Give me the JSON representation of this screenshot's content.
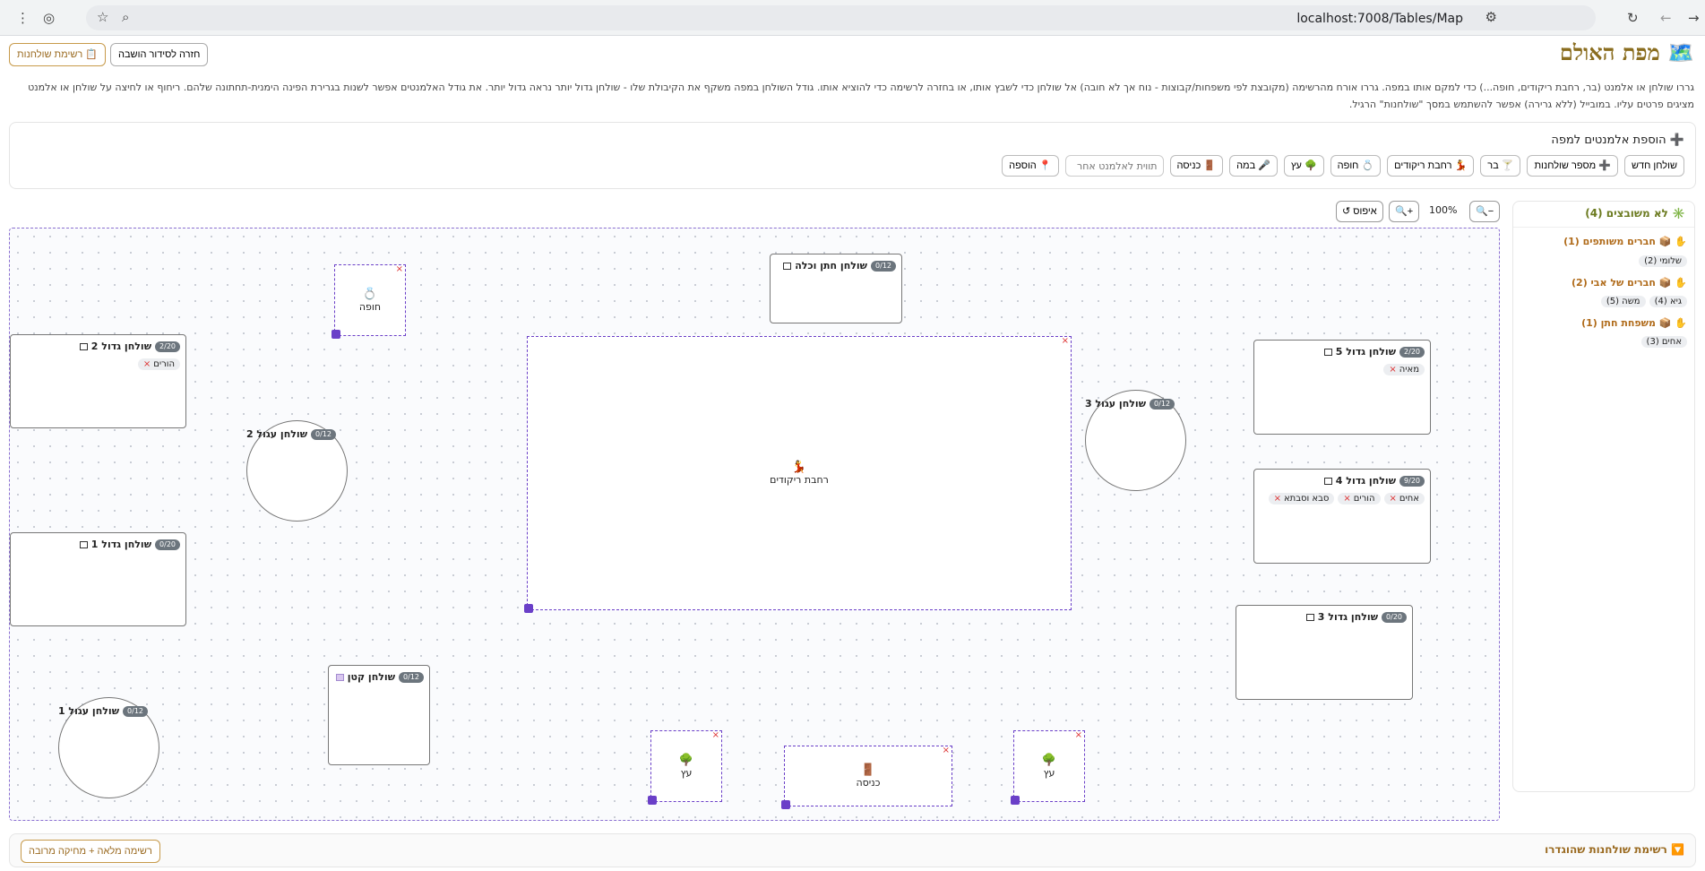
{
  "browser": {
    "url": "localhost:7008/Tables/Map",
    "icons": [
      "menu-dots-icon",
      "profile-icon",
      "star-icon",
      "zoom-icon",
      "site-settings-icon",
      "reload-icon",
      "back-icon",
      "forward-icon"
    ]
  },
  "header": {
    "title": "מפת האולם",
    "title_icon": "🗺️",
    "back_button": "חזרה לסידור הושבה",
    "tables_list_button": "📋 רשימת שולחנות",
    "description": "גררו שולחן או אלמנט (בר, רחבת ריקודים, חופה...) כדי למקם אותו במפה. גררו אורח מהרשימה (מקובצת לפי משפחות/קבוצות - נוח אך לא חובה) אל שולחן כדי לשבץ אותו, או בחזרה לרשימה כדי להוציא אותו. גודל השולחן במפה משקף את הקיבולת שלו - שולחן גדול יותר נראה גדול יותר. את גודל האלמנטים אפשר לשנות בגרירת הפינה הימנית-תחתונה שלהם. ריחוף או לחיצה על שולחן או אלמנט מציגים פרטים עליו. במובייל (ללא גרירה) אפשר להשתמש במסך \"שולחנות\" הרגיל."
  },
  "add_panel": {
    "title": "הוספת אלמנטים למפה",
    "title_icon": "➕",
    "buttons": [
      {
        "name": "new-table",
        "label": "שולחן חדש"
      },
      {
        "name": "table-count",
        "label": "➕ מספר שולחנות"
      },
      {
        "name": "bar",
        "label": "🍸 בר"
      },
      {
        "name": "dance-floor",
        "label": "💃 רחבת ריקודים"
      },
      {
        "name": "chuppah",
        "label": "💍 חופה"
      },
      {
        "name": "tree",
        "label": "🌳 עץ"
      },
      {
        "name": "stage",
        "label": "🎤 במה"
      },
      {
        "name": "entrance",
        "label": "🚪 כניסה"
      }
    ],
    "other_placeholder": "תווית לאלמנט אחר",
    "add_button": "📍 הוספה"
  },
  "zoom": {
    "zoom_out": "🔍−",
    "level": "100%",
    "zoom_in": "🔍+",
    "reset": "↺ איפוס"
  },
  "tables": [
    {
      "name": "שולחן חתן וכלה",
      "count": "0/12",
      "guests": []
    },
    {
      "name": "שולחן גדול 2",
      "count": "2/20",
      "guests": [
        "הורים"
      ]
    },
    {
      "name": "שולחן עגול 2",
      "count": "0/12",
      "guests": []
    },
    {
      "name": "שולחן גדול 1",
      "count": "0/20",
      "guests": []
    },
    {
      "name": "שולחן קטן",
      "count": "0/12",
      "guests": []
    },
    {
      "name": "שולחן עגול 1",
      "count": "0/12",
      "guests": []
    },
    {
      "name": "שולחן עגול 3",
      "count": "0/12",
      "guests": []
    },
    {
      "name": "שולחן גדול 5",
      "count": "2/20",
      "guests": [
        "מאיה"
      ]
    },
    {
      "name": "שולחן גדול 4",
      "count": "9/20",
      "guests": [
        "אחים",
        "הורים",
        "סבא וסבתא"
      ]
    },
    {
      "name": "שולחן גדול 3",
      "count": "0/20",
      "guests": []
    }
  ],
  "elements": [
    {
      "emoji": "💍",
      "label": "חופה"
    },
    {
      "emoji": "💃",
      "label": "רחבת ריקודים"
    },
    {
      "emoji": "🌳",
      "label": "עץ"
    },
    {
      "emoji": "🚪",
      "label": "כניסה"
    },
    {
      "emoji": "🌳",
      "label": "עץ"
    }
  ],
  "sidebar": {
    "title": "✳️ לא משובצים (4)",
    "groups": [
      {
        "title": "✋ 📦 חברים משותפים (1)",
        "guests": [
          "שלומי (2)"
        ]
      },
      {
        "title": "✋ 📦 חברים של אבי (2)",
        "guests": [
          "גיא (4)",
          "משה (5)"
        ]
      },
      {
        "title": "✋ 📦 משפחת חתן (1)",
        "guests": [
          "אחים (3)"
        ]
      }
    ]
  },
  "bottom": {
    "title": "🔽 רשימת שולחנות שהוגדרו",
    "button": "רשימה מלאה + מחיקה מרובה"
  }
}
